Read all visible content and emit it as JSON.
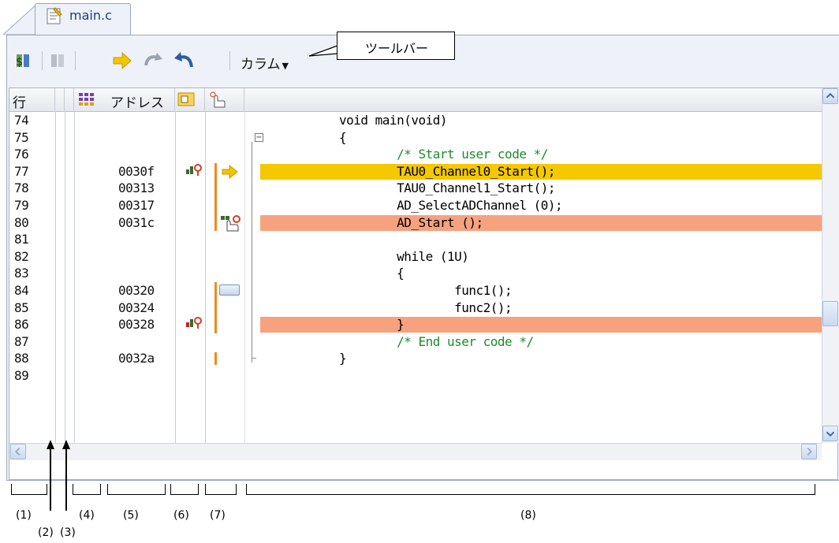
{
  "tab": {
    "label": "main.c"
  },
  "toolbar": {
    "column_menu_label": "カラム"
  },
  "callout": {
    "text": "ツールバー"
  },
  "header": {
    "line_label": "行",
    "address_label": "アドレス"
  },
  "rows": [
    {
      "line": "74",
      "address": "",
      "code": "void main(void)",
      "style": "plain",
      "kw": true
    },
    {
      "line": "75",
      "address": "",
      "code": "{",
      "style": "plain",
      "fold": true
    },
    {
      "line": "76",
      "address": "",
      "code": "        /* Start user code */",
      "style": "comment"
    },
    {
      "line": "77",
      "address": "0030f",
      "code": "        TAU0_Channel0_Start();",
      "style": "yellow",
      "marker": "event-current"
    },
    {
      "line": "78",
      "address": "00313",
      "code": "        TAU0_Channel1_Start();",
      "style": "plain"
    },
    {
      "line": "79",
      "address": "00317",
      "code": "        AD_SelectADChannel (0);",
      "style": "plain"
    },
    {
      "line": "80",
      "address": "0031c",
      "code": "        AD_Start ();",
      "style": "salmon",
      "marker": "breakpoint-hand"
    },
    {
      "line": "81",
      "address": "",
      "code": "",
      "style": "plain"
    },
    {
      "line": "82",
      "address": "",
      "code": "        while (1U)",
      "style": "plain"
    },
    {
      "line": "83",
      "address": "",
      "code": "        {",
      "style": "plain"
    },
    {
      "line": "84",
      "address": "00320",
      "code": "                func1();",
      "style": "plain",
      "marker": "bookmark"
    },
    {
      "line": "85",
      "address": "00324",
      "code": "                func2();",
      "style": "plain"
    },
    {
      "line": "86",
      "address": "00328",
      "code": "        }",
      "style": "salmon",
      "marker": "event-red"
    },
    {
      "line": "87",
      "address": "",
      "code": "        /* End user code */",
      "style": "comment"
    },
    {
      "line": "88",
      "address": "0032a",
      "code": "}",
      "style": "plain"
    },
    {
      "line": "89",
      "address": "",
      "code": "",
      "style": "plain"
    }
  ],
  "labels": [
    "(1)",
    "(2)",
    "(3)",
    "(4)",
    "(5)",
    "(6)",
    "(7)",
    "(8)"
  ],
  "colors": {
    "current_line": "#f5c800",
    "breakpoint_line": "#f6a27f",
    "selection_bar": "#f08a1c",
    "comment": "#1f8a2e",
    "keyword": "#7b2a8a"
  }
}
